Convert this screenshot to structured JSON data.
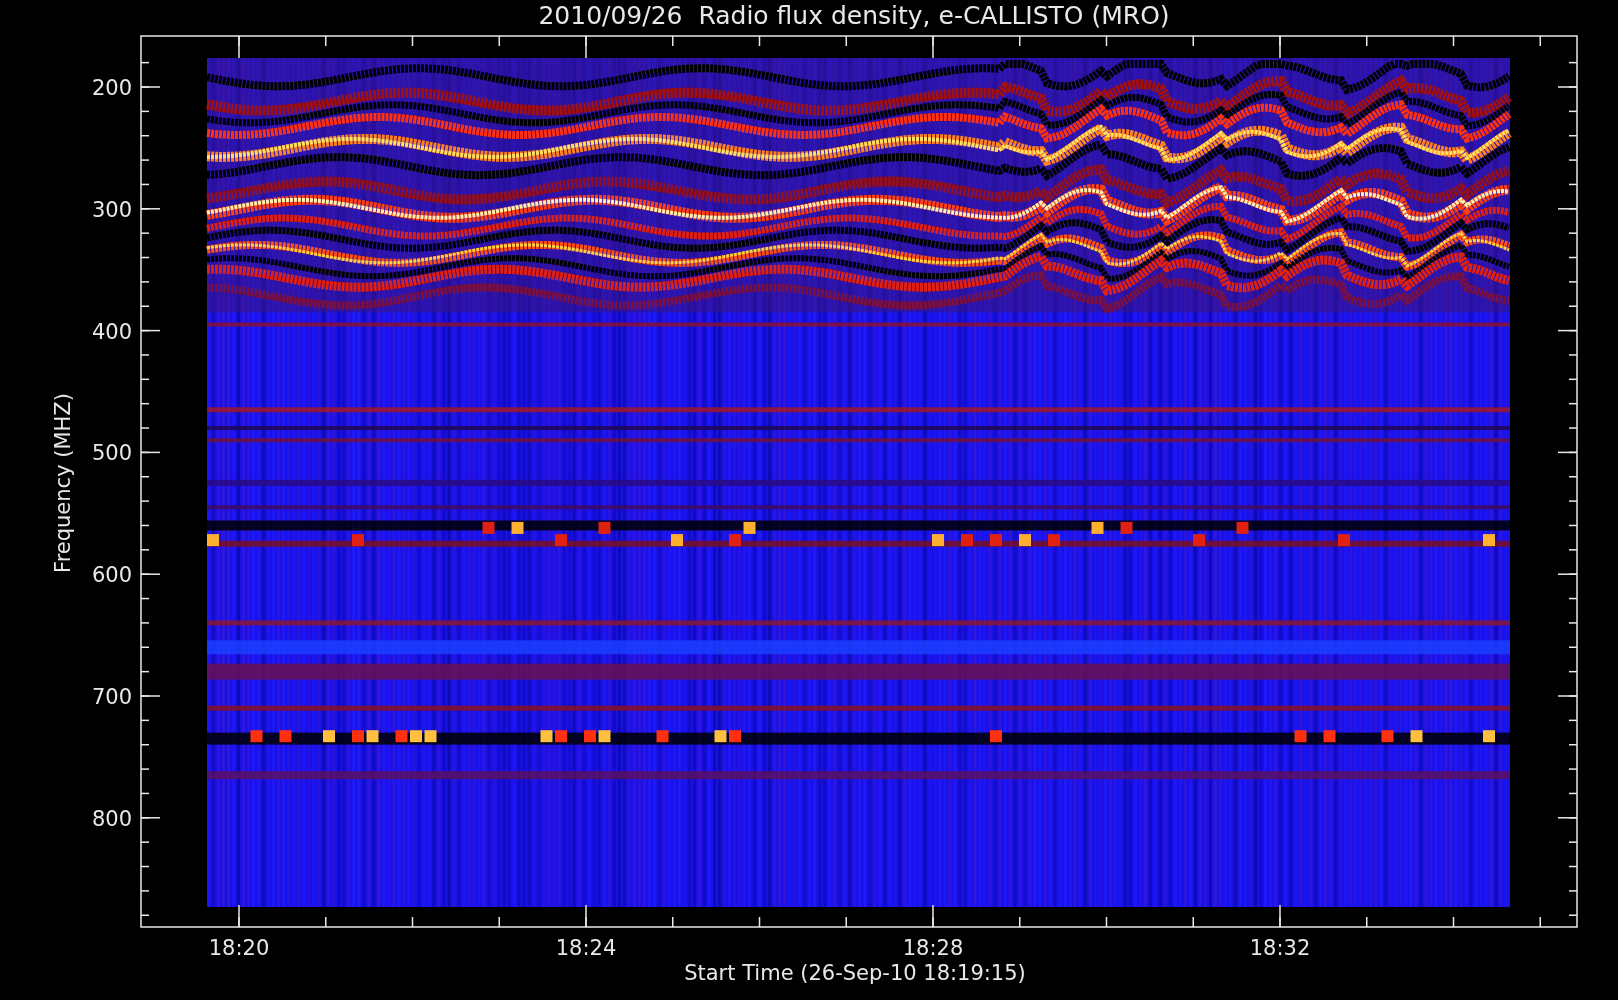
{
  "title": "2010/09/26  Radio flux density, e-CALLISTO (MRO)",
  "plot": {
    "ylabel": "Frequency (MHZ)",
    "xlabel": "Start Time (26-Sep-10 18:19:15)",
    "yticks": [
      "200",
      "300",
      "400",
      "500",
      "600",
      "700",
      "800"
    ],
    "xticks": [
      "18:20",
      "18:24",
      "18:28",
      "18:32"
    ]
  }
}
